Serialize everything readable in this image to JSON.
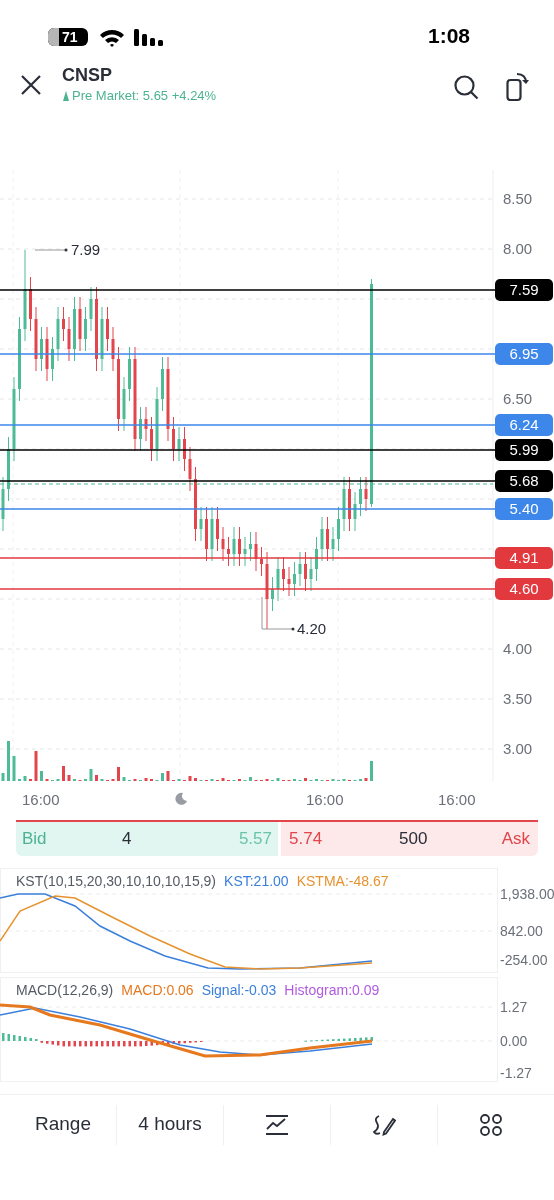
{
  "status_bar": {
    "battery": "71",
    "time": "1:08"
  },
  "header": {
    "symbol": "CNSP",
    "quote": "Pre Market: 5.65 +4.24%"
  },
  "price_chart": {
    "price_axis": [
      "8.50",
      "8.00",
      "6.50",
      "4.00",
      "3.50",
      "3.00"
    ],
    "price_lines": [
      {
        "label": "7.59",
        "color": "#000000"
      },
      {
        "label": "6.95",
        "color": "#3d86ea"
      },
      {
        "label": "6.24",
        "color": "#3d86ea"
      },
      {
        "label": "5.99",
        "color": "#000000"
      },
      {
        "label": "5.68",
        "color": "#000000"
      },
      {
        "label": "5.40",
        "color": "#3d86ea"
      },
      {
        "label": "4.91",
        "color": "#e2393f"
      },
      {
        "label": "4.60",
        "color": "#e2393f"
      }
    ],
    "high_callout": "7.99",
    "low_callout": "4.20",
    "time_axis": [
      "16:00",
      "16:00",
      "16:00"
    ]
  },
  "quote_bar": {
    "bid_label": "Bid",
    "bid_size": "4",
    "bid_price": "5.57",
    "ask_price": "5.74",
    "ask_size": "500",
    "ask_label": "Ask"
  },
  "indicators": [
    {
      "name": "KST(10,15,20,30,10,10,10,15,9)",
      "readouts": [
        {
          "text": "KST:21.00",
          "color": "#3b7fdc"
        },
        {
          "text": "KSTMA:-48.67",
          "color": "#e6922e"
        }
      ],
      "axis": [
        "1,938.00",
        "842.00",
        "-254.00"
      ]
    },
    {
      "name": "MACD(12,26,9)",
      "readouts": [
        {
          "text": "MACD:0.06",
          "color": "#e6781e"
        },
        {
          "text": "Signal:-0.03",
          "color": "#3b7fdc"
        },
        {
          "text": "Histogram:0.09",
          "color": "#b05be0"
        }
      ],
      "axis": [
        "1.27",
        "0.00",
        "-1.27"
      ]
    }
  ],
  "toolbar": [
    {
      "kind": "text",
      "label": "Range"
    },
    {
      "kind": "text",
      "label": "4 hours"
    },
    {
      "kind": "indicators"
    },
    {
      "kind": "draw"
    },
    {
      "kind": "grid"
    }
  ]
}
